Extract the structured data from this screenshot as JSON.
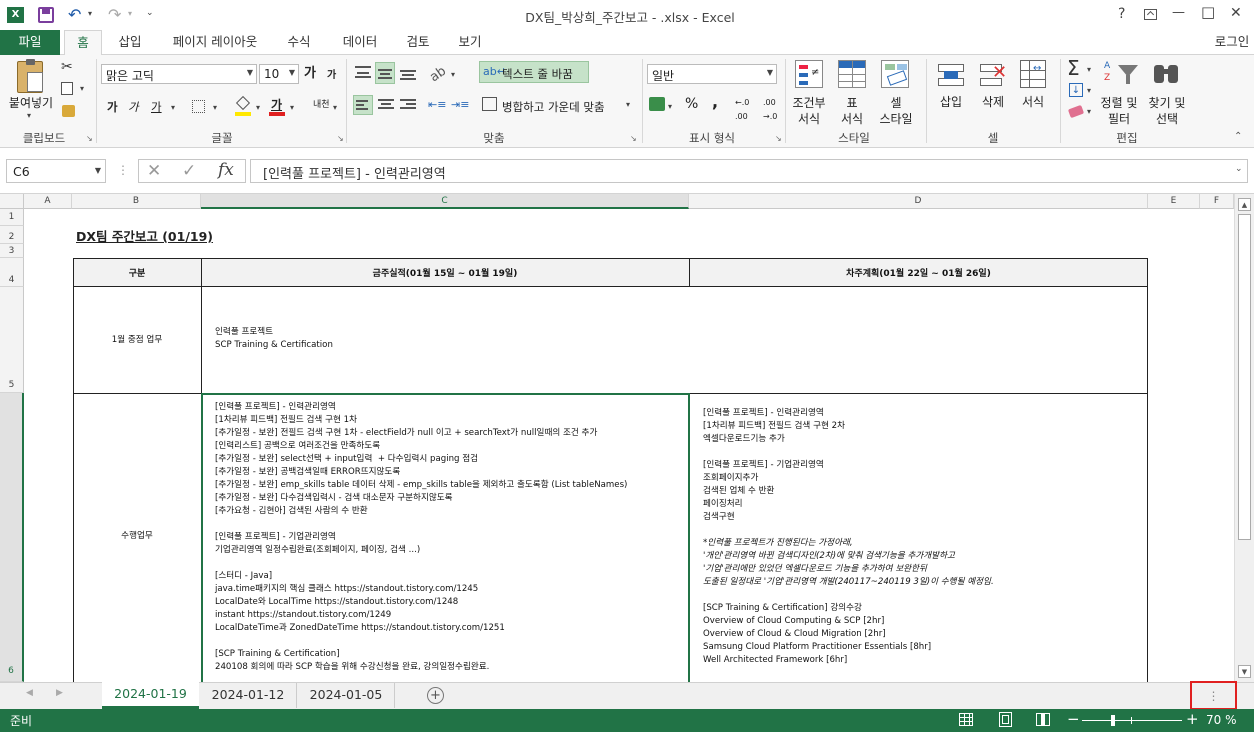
{
  "titlebar": {
    "title": "DX팀_박상희_주간보고 - .xlsx - Excel",
    "help": "?",
    "minimize": "—",
    "maximize": "□",
    "close": "✕"
  },
  "tabs": [
    {
      "label": "파일"
    },
    {
      "label": "홈"
    },
    {
      "label": "삽입"
    },
    {
      "label": "페이지 레이아웃"
    },
    {
      "label": "수식"
    },
    {
      "label": "데이터"
    },
    {
      "label": "검토"
    },
    {
      "label": "보기"
    }
  ],
  "signin": "로그인",
  "ribbon": {
    "clipboard": {
      "paste": "붙여넣기",
      "label": "클립보드"
    },
    "font": {
      "name": "맑은 고딕",
      "size": "10",
      "grow": "가",
      "shrink": "가",
      "bold": "가",
      "italic": "가",
      "underline": "가",
      "color_a": "가",
      "phonetic": "내천",
      "label": "글꼴"
    },
    "align": {
      "wrap": "텍스트 줄 바꿈",
      "merge": "병합하고 가운데 맞춤",
      "label": "맞춤"
    },
    "number": {
      "format": "일반",
      "percent": "%",
      "comma": ",",
      "inc": ".00 →.0",
      "label": "표시 형식"
    },
    "styles": {
      "conditional": "조건부\n서식",
      "table": "표\n서식",
      "cell": "셀\n스타일",
      "label": "스타일"
    },
    "cells": {
      "insert": "삽입",
      "delete": "삭제",
      "format": "서식",
      "label": "셀"
    },
    "editing": {
      "sort": "정렬 및\n필터",
      "find": "찾기 및\n선택",
      "label": "편집"
    }
  },
  "formula_bar": {
    "name_box": "C6",
    "cancel": "✕",
    "enter": "✓",
    "fx": "fx",
    "content": "[인력풀 프로젝트] - 인력관리영역"
  },
  "columns": [
    "A",
    "B",
    "C",
    "D",
    "E",
    "F"
  ],
  "rows": [
    "1",
    "2",
    "3",
    "4",
    "5",
    "6"
  ],
  "sheet": {
    "title": "DX팀 주간보고 (01/19)",
    "header_category": "구분",
    "header_this_week": "금주실적(01월 15일 ~ 01월 19일)",
    "header_next_week": "차주계획(01월 22일 ~ 01월 26일)",
    "row5_label": "1월 중점 업무",
    "row5_content": "인력풀 프로젝트\nSCP Training & Certification",
    "row6_label": "수행업무",
    "row6_this_week": "[인력풀 프로젝트] - 인력관리영역\n[1차리뷰 피드백] 전필드 검색 구현 1차\n[추가일정 - 보완] 전필드 검색 구현 1차 - electField가 null 이고 + searchText가 null일때의 조건 추가\n[인력리스트] 공백으로 여러조건을 만족하도록\n[추가일정 - 보완] select선택 + input입력  + 다수입력시 paging 점검\n[추가일정 - 보완] 공백검색일때 ERROR뜨지않도록\n[추가일정 - 보완] emp_skills table 데이터 삭제 - emp_skills table을 제외하고 출도록함 (List tableNames)\n[추가일정 - 보완] 다수검색입력시 - 검색 대소문자 구분하지않도록\n[추가요청 - 김현아] 검색된 사람의 수 반환\n\n[인력풀 프로젝트] - 기업관리영역\n기업관리영역 일정수립완료(조회페이지, 페이징, 검색 ...)\n\n[스터디 - Java]\njava.time패키지의 핵심 클래스 https://standout.tistory.com/1245\nLocalDate와 LocalTime https://standout.tistory.com/1248\ninstant https://standout.tistory.com/1249\nLocalDateTime과 ZonedDateTime https://standout.tistory.com/1251\n\n[SCP Training & Certification]\n240108 회의에 따라 SCP 학습을 위해 수강신청을 완료, 강의일정수립완료.",
    "row6_next_week_a": "[인력풀 프로젝트] - 인력관리영역\n[1차리뷰 피드백] 전필드 검색 구현 2차\n엑셀다운로드기능 추가\n\n[인력풀 프로젝트] - 기업관리영역\n조회페이지추가\n검색된 업체 수 반환\n페이징처리\n검색구현",
    "row6_next_week_b": "*인력풀 프로젝트가 진행된다는 가정아래,\n'개인'관리영역 바뀐 검색디자인(2차)에 맞춰 검색기능을 추가개발하고\n'기업'관리에만 있었던 엑셀다운로드 기능을 추가하여 보완한뒤\n도출된 일정대로 '기업'관리영역 개발(240117~240119 3일)이 수행될 예정임.",
    "row6_next_week_c": "[SCP Training & Certification] 강의수강\nOverview of Cloud Computing & SCP [2hr]\nOverview of Cloud & Cloud Migration [2hr]\nSamsung Cloud Platform Practitioner Essentials [8hr]\nWell Architected Framework [6hr]"
  },
  "sheet_tabs": [
    {
      "label": "2024-01-19"
    },
    {
      "label": "2024-01-12"
    },
    {
      "label": "2024-01-05"
    }
  ],
  "status": {
    "ready": "준비",
    "zoom": "70 %",
    "minus": "−",
    "plus": "+"
  },
  "colors": {
    "excel_green": "#217346",
    "highlight_red": "#e02020"
  }
}
